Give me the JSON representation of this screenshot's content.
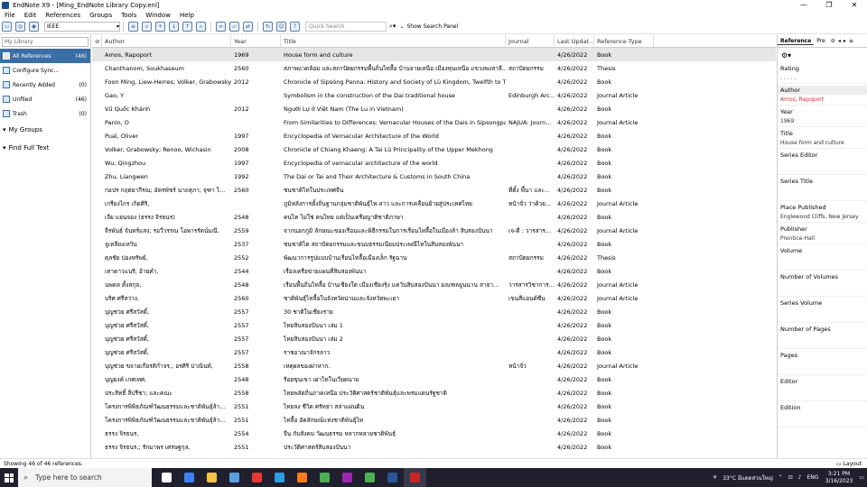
{
  "window": {
    "title": "EndNote X9 - [Ming_EndNote Library Copy.enl]",
    "minimize": "—",
    "restore": "❐",
    "close": "✕"
  },
  "menu": [
    "File",
    "Edit",
    "References",
    "Groups",
    "Tools",
    "Window",
    "Help"
  ],
  "toolbar": {
    "style_value": "IEEE",
    "quick_search_placeholder": "Quick Search",
    "show_search_panel": "Show Search Panel"
  },
  "left_panel": {
    "library_placeholder": "My Library",
    "groups": [
      {
        "label": "All References",
        "count": "(46)",
        "selected": true
      },
      {
        "label": "Configure Sync...",
        "count": ""
      },
      {
        "label": "Recently Added",
        "count": "(0)"
      },
      {
        "label": "Unfiled",
        "count": "(46)"
      },
      {
        "label": "Trash",
        "count": "(0)"
      }
    ],
    "my_groups": "My Groups",
    "find_full_text": "Find Full Text"
  },
  "table": {
    "headers": [
      "Author",
      "Year",
      "Title",
      "Journal",
      "Last Updat...",
      "Reference Type"
    ],
    "rows": [
      [
        "Amos, Rapoport",
        "1969",
        "House form and culture",
        "",
        "4/26/2022",
        "Book"
      ],
      [
        "Chanthanom, Soukhaseum",
        "2560",
        "สภาพแวดล้อม และสถาปัตยกรรมพื้นถิ่นไทลื้อ บ้านจายเหนือ เมืองหุนเหนือ แขวงพงสาลี...",
        "สถาปัตยกรรม",
        "4/26/2022",
        "Thesis"
      ],
      [
        "Foon Ming, Liew-Herres; Volker, Grabowsky...",
        "2012",
        "Chronicle of Sipsòng Panna: History and Society of Lü Kingdom, Twelfth to T...",
        "",
        "4/26/2022",
        "Book"
      ],
      [
        "Gao, Y",
        "",
        "Symbolism in the construction of the Dai traditional house",
        "Edinburgh Arc...",
        "4/26/2022",
        "Journal Article"
      ],
      [
        "Vũ Quốc Khánh",
        "2012",
        "Người Lự ở Việt Nam (The Lu in Vietnam)",
        "",
        "4/26/2022",
        "Book"
      ],
      [
        "Panin, O",
        "",
        "From Similarities to Differences: Vernacular Houses of the Dais in Sipsongpa...",
        "NAJUA: Journ...",
        "4/26/2022",
        "Journal Article"
      ],
      [
        "Pual, Oliver",
        "1997",
        "Encyclopedia of Vernacular Architecture of the World",
        "",
        "4/26/2022",
        "Book"
      ],
      [
        "Volker, Grabowsky; Renoo, Wichasin",
        "2008",
        "Chronicle of Chiang Khaeng: A Tai Lü Principality of the Upper Mekhong",
        "",
        "4/26/2022",
        "Book"
      ],
      [
        "Wu, Qingzhou",
        "1997",
        "Encyclopedia of vernacular architecture of the world",
        "",
        "4/26/2022",
        "Book"
      ],
      [
        "Zhu, Liangwen",
        "1992",
        "The Dai or Tai and Their Architecture & Customs in South China",
        "",
        "4/26/2022",
        "Book"
      ],
      [
        "กอปร กฤตยากีรณ; อัครพัชร์ นาถสุภา; จุฑา ไ...",
        "2560",
        "ชนชาติไทในประเทศจีน",
        "ที่ตั้ง พื้นา และ...",
        "4/26/2022",
        "Book"
      ],
      [
        "เกรียงไกร เกิดศิริ,",
        "",
        "ภูมิหลังการตั้งถิ่นฐานกลุ่มชาติพันธุ์ไท-ลาว และการเคลื่อนย้ายสู่ประเทศไทย",
        "หน้าจั่ว ว่าด้วย...",
        "4/26/2022",
        "Journal Article"
      ],
      [
        "เจีย แยนจอง (ธรรง จิรธนร)",
        "2548",
        "คนไท ไม่ใช่ คนไทย แต่เป็นเครือญาติชาติภาษา",
        "",
        "4/26/2022",
        "Book"
      ],
      [
        "จีรพันธ์ จันทร์แสง; รอวีวรรณ โอพารรัตน์มณี,",
        "2559",
        "จากนอกภูมิ ลักษณะของเรือนและพิธีกรรมในการเรือนไทลื้อในเมืองล้า สิบสองปันนา",
        "เจ-ดี : วารสาร...",
        "4/26/2022",
        "Journal Article"
      ],
      [
        "จูเหลียงเหวิน",
        "2537",
        "ชนชาติไต สถาปัตยกรรมและขนบธรรมเนียมประเพณีไทในสิบสองพันนา",
        "",
        "4/26/2022",
        "Book"
      ],
      [
        "ดุลชัย ปองทรัพย์,",
        "2552",
        "พัฒนาการรูปแบบบ้านเรือนไทลื้อเมืองเล็ก รัฐฉาน",
        "สถาปัตยกรรม",
        "4/26/2022",
        "Thesis"
      ],
      [
        "เท่าดาวแนริ; อ้ายคำ,",
        "2544",
        "เรื่องเครือข่ายแผนที่สิบสองพันนา",
        "",
        "4/26/2022",
        "Book"
      ],
      [
        "นพดล ตั้งสกุล,",
        "2548",
        "เรือนพื้นถิ่นไทลื้อ บ้านเชียงใต เมืองเชียงรุ้ง แคว้นสิบสองปันนา มณฑลยูนนาน สาธา...",
        "วารสารวิชาการ...",
        "4/26/2022",
        "Journal Article"
      ],
      [
        "บริศ ศรีสว่าง,",
        "2560",
        "ชาติพันธุ์ไทลื้อในจังหวัดน่านและจังหวัดพะเยา",
        "เขนสีแอนด์ซีน",
        "4/26/2022",
        "Journal Article"
      ],
      [
        "บุญช่วย ศรีสวัสดิ์,",
        "2557",
        "30 ชาติในเชียงราย",
        "",
        "4/26/2022",
        "Book"
      ],
      [
        "บุญช่วย ศรีสวัสดิ์,",
        "2557",
        "ไทยสิบสองปันนา เล่ม 1",
        "",
        "4/26/2022",
        "Book"
      ],
      [
        "บุญช่วย ศรีสวัสดิ์,",
        "2557",
        "ไทยสิบสองปันนา เล่ม 2",
        "",
        "4/26/2022",
        "Book"
      ],
      [
        "บุญช่วย ศรีสวัสดิ์,",
        "2557",
        "ราชอาณาจักรลาว",
        "",
        "4/26/2022",
        "Book"
      ],
      [
        "บุญช่วย ขจายเกียรติกำจร,; อรศิริ ปาณินท์,",
        "2558",
        "เหตุผลของฝาหาก.",
        "หน้าจั่ว",
        "4/26/2022",
        "Journal Article"
      ],
      [
        "บุญยงค์ เกศเทศ,",
        "2548",
        "ร้อยขุนเขา เผ่าไทในเวียดนาม",
        "",
        "4/26/2022",
        "Book"
      ],
      [
        "ประสิทธิ์ ลีปรีชา; และคณะ",
        "2558",
        "ไทยพลัดถิ่นภาคเหนือ ประวัติศาสตร์ชาติพันธุ์และพรมแดนรัฐชาติ",
        "",
        "4/26/2022",
        "Book"
      ],
      [
        "โครงการพิพิธภัณฑ์วัฒนธรรมและชาติพันธุ์ล้า...",
        "2551",
        "ไทยลง ชีวิต ศรัทธา สล่าแผ่นดิน",
        "",
        "4/26/2022",
        "Book"
      ],
      [
        "โครงการพิพิธภัณฑ์วัฒนธรรมและชาติพันธุ์ล้า...",
        "2551",
        "ไทลื้อ อัตลักษณ์แห่งชาติพันธุ์ไท",
        "",
        "4/26/2022",
        "Book"
      ],
      [
        "ธรรง จิรธนร,",
        "2554",
        "จีน กับสังคม วัฒนธรรม หลากหลายชาติพันธุ์",
        "",
        "4/26/2022",
        "Book"
      ],
      [
        "ธรรง จิรธนร,; รักมาพร เศรษฐกุล,",
        "2551",
        "ประวัติศาสตร์สิบสองปันนา",
        "",
        "4/26/2022",
        "Book"
      ]
    ]
  },
  "right_panel": {
    "tabs": [
      "Reference",
      "Pre"
    ],
    "rating_label": "Rating",
    "rating_dots": ". . . . .",
    "fields": [
      {
        "label": "Author",
        "value": "Amos, Rapoport",
        "highlight": true,
        "red": true
      },
      {
        "label": "Year",
        "value": "1969"
      },
      {
        "label": "Title",
        "value": "House form and culture"
      },
      {
        "label": "Series Editor",
        "value": ""
      },
      {
        "label": "Series Title",
        "value": ""
      },
      {
        "label": "Place Published",
        "value": "Englewood Cliffs, New Jersey"
      },
      {
        "label": "Publisher",
        "value": "Prentice-Hall"
      },
      {
        "label": "Volume",
        "value": ""
      },
      {
        "label": "Number of Volumes",
        "value": ""
      },
      {
        "label": "Series Volume",
        "value": ""
      },
      {
        "label": "Number of Pages",
        "value": ""
      },
      {
        "label": "Pages",
        "value": ""
      },
      {
        "label": "Editor",
        "value": ""
      },
      {
        "label": "Edition",
        "value": ""
      }
    ]
  },
  "status": {
    "text": "Showing 46 of 46 references.",
    "layout": "Layout"
  },
  "taskbar": {
    "search_placeholder": "Type here to search",
    "weather": "33°C  มีแดดส่วนใหญ่",
    "lang": "ENG",
    "time": "3:21 PM",
    "date": "3/16/2023",
    "apps": [
      {
        "name": "task-view",
        "color": "#ffffff"
      },
      {
        "name": "widgets",
        "color": "#3b82f6"
      },
      {
        "name": "file-explorer",
        "color": "#f5c542"
      },
      {
        "name": "store",
        "color": "#5aa0e0"
      },
      {
        "name": "opera",
        "color": "#e53935"
      },
      {
        "name": "edge",
        "color": "#2e9ce6"
      },
      {
        "name": "firefox",
        "color": "#ff7b1c"
      },
      {
        "name": "chrome",
        "color": "#4caf50"
      },
      {
        "name": "photos",
        "color": "#9c27b0"
      },
      {
        "name": "chrome-2",
        "color": "#4caf50"
      },
      {
        "name": "word",
        "color": "#2b579a"
      },
      {
        "name": "endnote",
        "color": "#c62828"
      }
    ]
  }
}
